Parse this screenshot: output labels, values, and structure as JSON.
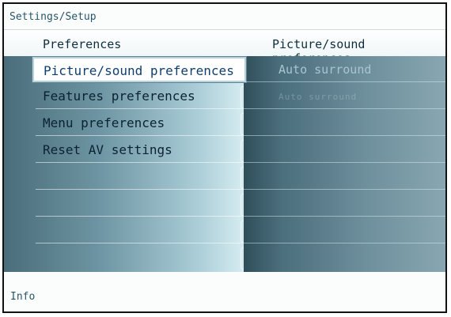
{
  "title": "Settings/Setup",
  "header": {
    "left": "Preferences",
    "right": "Picture/sound preferences"
  },
  "menu": {
    "items": [
      {
        "label": "Picture/sound preferences",
        "selected": true
      },
      {
        "label": "Features preferences"
      },
      {
        "label": "Menu preferences"
      },
      {
        "label": "Reset AV settings"
      },
      {
        "label": ""
      },
      {
        "label": ""
      },
      {
        "label": ""
      },
      {
        "label": ""
      }
    ]
  },
  "submenu": {
    "items": [
      {
        "label": "Auto surround"
      },
      {
        "label": "Auto surround"
      },
      {
        "label": ""
      },
      {
        "label": ""
      },
      {
        "label": ""
      },
      {
        "label": ""
      },
      {
        "label": ""
      },
      {
        "label": ""
      }
    ]
  },
  "info": "Info",
  "colors": {
    "selected_text": "#0f3f6f",
    "title_text": "#27566a"
  }
}
